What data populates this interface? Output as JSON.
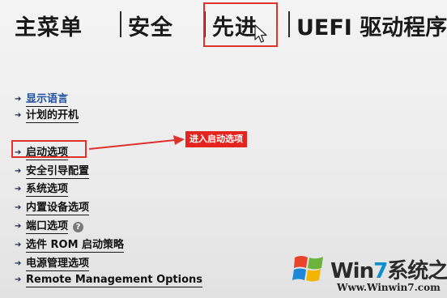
{
  "tabs": [
    {
      "label": "主菜单"
    },
    {
      "label": "安全"
    },
    {
      "label": "先进"
    },
    {
      "label": "UEFI 驱动程序"
    }
  ],
  "menu": {
    "items": [
      {
        "label": "显示语言"
      },
      {
        "label": "计划的开机"
      },
      {
        "label": "启动选项"
      },
      {
        "label": "安全引导配置"
      },
      {
        "label": "系统选项"
      },
      {
        "label": "内置设备选项"
      },
      {
        "label": "端口选项"
      },
      {
        "label": "选件 ROM 启动策略"
      },
      {
        "label": "电源管理选项"
      },
      {
        "label": "Remote Management Options"
      }
    ],
    "help_glyph": "?"
  },
  "annotation": {
    "text": "进入启动选项"
  },
  "watermark": {
    "brand_prefix": "Win",
    "brand_number": "7",
    "brand_suffix": "系统之家",
    "url": "Www.Winwin7.com"
  },
  "colors": {
    "highlight": "#e0312c",
    "link": "#1e4fa3"
  }
}
